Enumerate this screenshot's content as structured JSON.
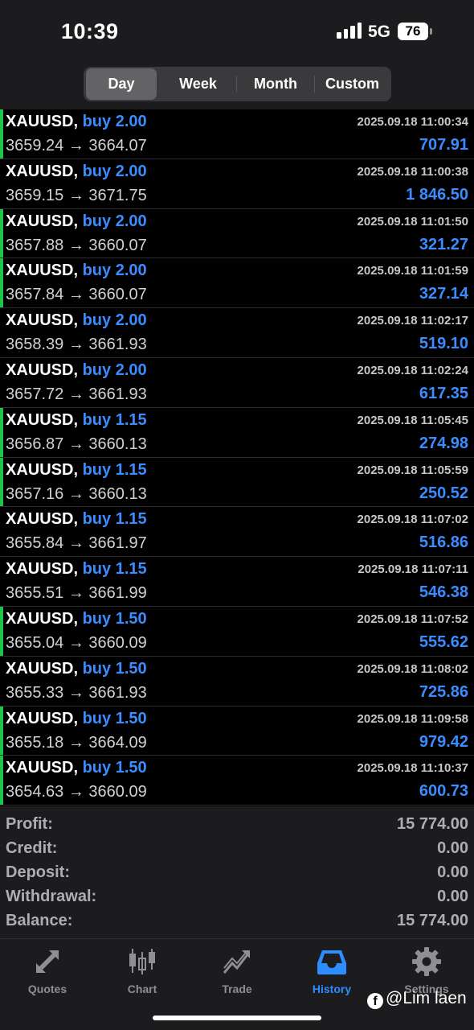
{
  "status_bar": {
    "time": "10:39",
    "network": "5G",
    "battery": "76"
  },
  "period_tabs": [
    {
      "label": "Day",
      "active": true
    },
    {
      "label": "Week",
      "active": false
    },
    {
      "label": "Month",
      "active": false
    },
    {
      "label": "Custom",
      "active": false
    }
  ],
  "deals": [
    {
      "symbol": "XAUUSD,",
      "side": "buy 2.00",
      "time": "2025.09.18 11:00:34",
      "open": "3659.24",
      "arrow": "→",
      "close": "3664.07",
      "profit": "707.91",
      "marked": true
    },
    {
      "symbol": "XAUUSD,",
      "side": "buy 2.00",
      "time": "2025.09.18 11:00:38",
      "open": "3659.15",
      "arrow": "→",
      "close": "3671.75",
      "profit": "1 846.50",
      "marked": false
    },
    {
      "symbol": "XAUUSD,",
      "side": "buy 2.00",
      "time": "2025.09.18 11:01:50",
      "open": "3657.88",
      "arrow": "→",
      "close": "3660.07",
      "profit": "321.27",
      "marked": true
    },
    {
      "symbol": "XAUUSD,",
      "side": "buy 2.00",
      "time": "2025.09.18 11:01:59",
      "open": "3657.84",
      "arrow": "→",
      "close": "3660.07",
      "profit": "327.14",
      "marked": true
    },
    {
      "symbol": "XAUUSD,",
      "side": "buy 2.00",
      "time": "2025.09.18 11:02:17",
      "open": "3658.39",
      "arrow": "→",
      "close": "3661.93",
      "profit": "519.10",
      "marked": false
    },
    {
      "symbol": "XAUUSD,",
      "side": "buy 2.00",
      "time": "2025.09.18 11:02:24",
      "open": "3657.72",
      "arrow": "→",
      "close": "3661.93",
      "profit": "617.35",
      "marked": false
    },
    {
      "symbol": "XAUUSD,",
      "side": "buy 1.15",
      "time": "2025.09.18 11:05:45",
      "open": "3656.87",
      "arrow": "→",
      "close": "3660.13",
      "profit": "274.98",
      "marked": true
    },
    {
      "symbol": "XAUUSD,",
      "side": "buy 1.15",
      "time": "2025.09.18 11:05:59",
      "open": "3657.16",
      "arrow": "→",
      "close": "3660.13",
      "profit": "250.52",
      "marked": true
    },
    {
      "symbol": "XAUUSD,",
      "side": "buy 1.15",
      "time": "2025.09.18 11:07:02",
      "open": "3655.84",
      "arrow": "→",
      "close": "3661.97",
      "profit": "516.86",
      "marked": false
    },
    {
      "symbol": "XAUUSD,",
      "side": "buy 1.15",
      "time": "2025.09.18 11:07:11",
      "open": "3655.51",
      "arrow": "→",
      "close": "3661.99",
      "profit": "546.38",
      "marked": false
    },
    {
      "symbol": "XAUUSD,",
      "side": "buy 1.50",
      "time": "2025.09.18 11:07:52",
      "open": "3655.04",
      "arrow": "→",
      "close": "3660.09",
      "profit": "555.62",
      "marked": true
    },
    {
      "symbol": "XAUUSD,",
      "side": "buy 1.50",
      "time": "2025.09.18 11:08:02",
      "open": "3655.33",
      "arrow": "→",
      "close": "3661.93",
      "profit": "725.86",
      "marked": false
    },
    {
      "symbol": "XAUUSD,",
      "side": "buy 1.50",
      "time": "2025.09.18 11:09:58",
      "open": "3655.18",
      "arrow": "→",
      "close": "3664.09",
      "profit": "979.42",
      "marked": true
    },
    {
      "symbol": "XAUUSD,",
      "side": "buy 1.50",
      "time": "2025.09.18 11:10:37",
      "open": "3654.63",
      "arrow": "→",
      "close": "3660.09",
      "profit": "600.73",
      "marked": true
    }
  ],
  "summary": [
    {
      "label": "Profit:",
      "value": "15 774.00"
    },
    {
      "label": "Credit:",
      "value": "0.00"
    },
    {
      "label": "Deposit:",
      "value": "0.00"
    },
    {
      "label": "Withdrawal:",
      "value": "0.00"
    },
    {
      "label": "Balance:",
      "value": "15 774.00"
    }
  ],
  "tabs": [
    {
      "label": "Quotes",
      "icon": "quotes-icon",
      "active": false
    },
    {
      "label": "Chart",
      "icon": "chart-icon",
      "active": false
    },
    {
      "label": "Trade",
      "icon": "trade-icon",
      "active": false
    },
    {
      "label": "History",
      "icon": "history-icon",
      "active": true
    },
    {
      "label": "Settings",
      "icon": "settings-icon",
      "active": false
    }
  ],
  "watermark": {
    "icon": "facebook-icon",
    "text": "@Lim laen"
  },
  "colors": {
    "buy": "#3a8cff",
    "profit": "#3a8cff",
    "marker": "#1fc44a",
    "active_tab": "#2d8cff",
    "background": "#000000",
    "panel": "#1c1c1e"
  }
}
